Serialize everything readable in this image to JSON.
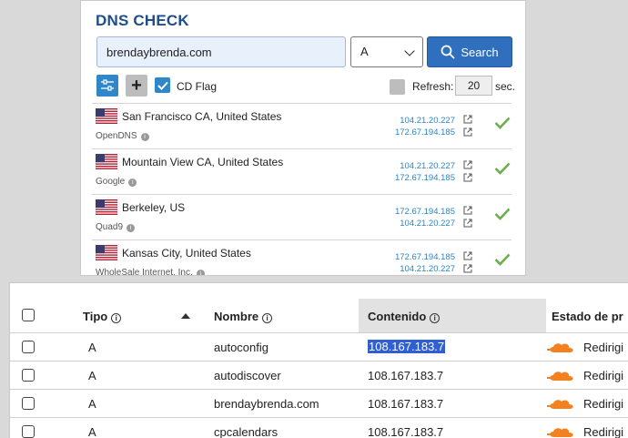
{
  "dns_check": {
    "title": "DNS CHECK",
    "domain_value": "brendaybrenda.com",
    "record_type": "A",
    "search_label": "Search",
    "cd_flag_label": "CD Flag",
    "refresh_label": "Refresh:",
    "refresh_value": "20",
    "refresh_unit": "sec.",
    "servers": [
      {
        "location": "San Francisco CA, United States",
        "provider": "OpenDNS",
        "ips": [
          "104.21.20.227",
          "172.67.194.185"
        ]
      },
      {
        "location": "Mountain View CA, United States",
        "provider": "Google",
        "ips": [
          "104.21.20.227",
          "172.67.194.185"
        ]
      },
      {
        "location": "Berkeley, US",
        "provider": "Quad9",
        "ips": [
          "172.67.194.185",
          "104.21.20.227"
        ]
      },
      {
        "location": "Kansas City, United States",
        "provider": "WholeSale Internet, Inc.",
        "ips": [
          "172.67.194.185",
          "104.21.20.227"
        ]
      }
    ],
    "colors": {
      "accent": "#2f6fbd",
      "link": "#2a85c6",
      "check": "#6ab04c",
      "title": "#1f4e8c"
    }
  },
  "dns_table": {
    "headers": {
      "tipo": "Tipo",
      "nombre": "Nombre",
      "contenido": "Contenido",
      "estado": "Estado de pr"
    },
    "rows": [
      {
        "tipo": "A",
        "nombre": "autoconfig",
        "contenido": "108.167.183.7",
        "estado": "Redirigi"
      },
      {
        "tipo": "A",
        "nombre": "autodiscover",
        "contenido": "108.167.183.7",
        "estado": "Redirigi"
      },
      {
        "tipo": "A",
        "nombre": "brendaybrenda.com",
        "contenido": "108.167.183.7",
        "estado": "Redirigi"
      },
      {
        "tipo": "A",
        "nombre": "cpcalendars",
        "contenido": "108.167.183.7",
        "estado": "Redirigi"
      }
    ],
    "colors": {
      "cloud": "#f48120",
      "selection": "#2f5fd1"
    }
  }
}
